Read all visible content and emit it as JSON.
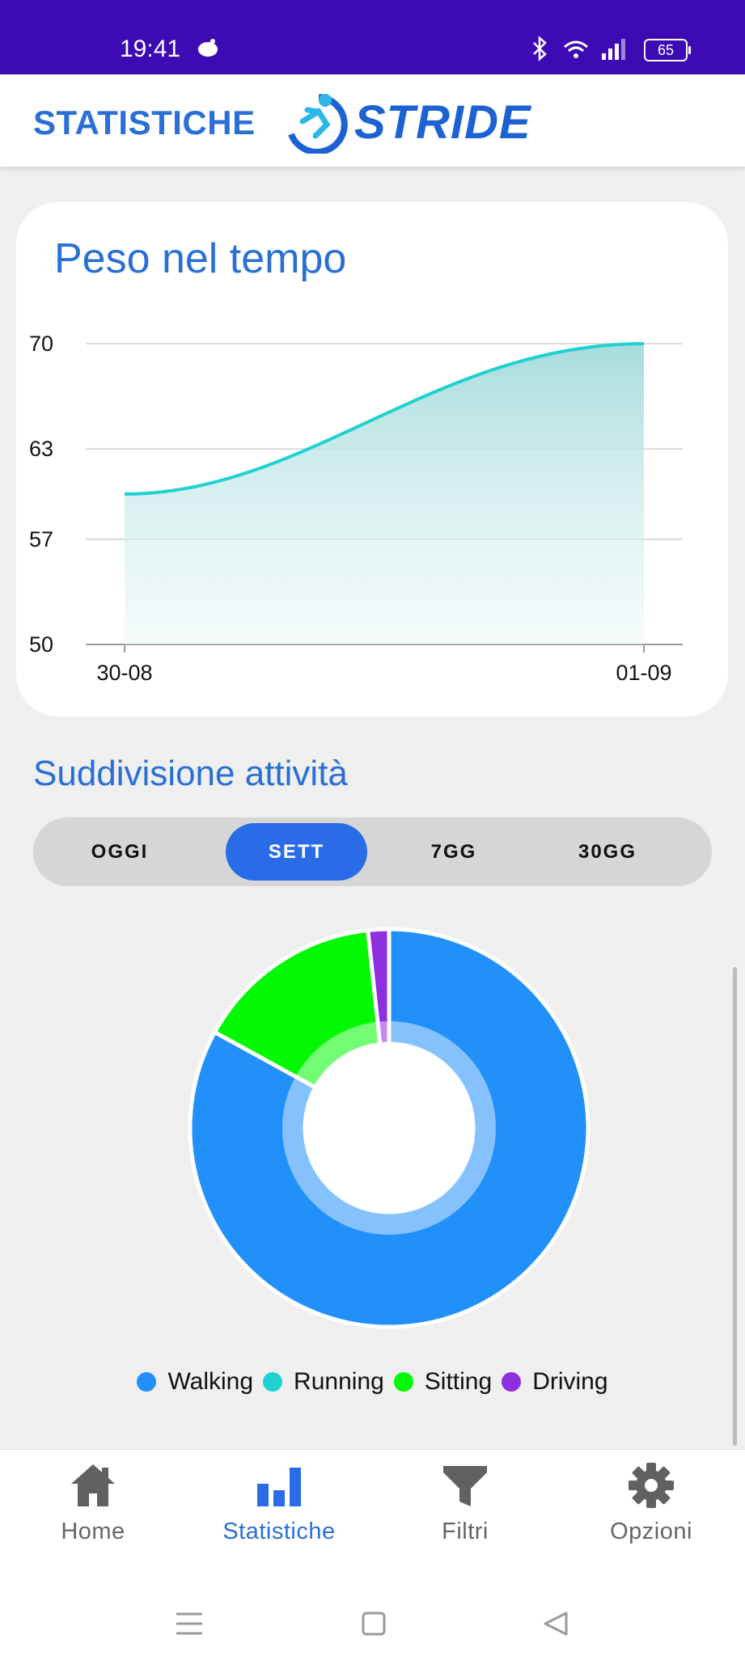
{
  "status_bar": {
    "time": "19:41",
    "battery": "65"
  },
  "header": {
    "title": "STATISTICHE",
    "logo_text": "STRIDE"
  },
  "weight_card": {
    "title": "Peso nel tempo"
  },
  "chart_data": {
    "type": "area",
    "x": [
      "30-08",
      "01-09"
    ],
    "y_ticks": [
      70,
      63,
      57,
      50
    ],
    "ylim": [
      50,
      70
    ],
    "series": [
      {
        "values": [
          60,
          70
        ]
      }
    ],
    "color": "#1fd1d1",
    "grid": true
  },
  "activity": {
    "title": "Suddivisione attività",
    "tabs": [
      "OGGI",
      "SETT",
      "7GG",
      "30GG"
    ],
    "selected_tab": "SETT",
    "donut": {
      "slices": [
        {
          "name": "Walking",
          "value": 83,
          "color": "#2290fb"
        },
        {
          "name": "Running",
          "value": 0,
          "color": "#1fd1d1"
        },
        {
          "name": "Sitting",
          "value": 15.3,
          "color": "#03f903"
        },
        {
          "name": "Driving",
          "value": 1.7,
          "color": "#8e2fe0"
        }
      ]
    },
    "legend": [
      {
        "label": "Walking",
        "color": "#2290fb"
      },
      {
        "label": "Running",
        "color": "#1fd1d1"
      },
      {
        "label": "Sitting",
        "color": "#03f903"
      },
      {
        "label": "Driving",
        "color": "#8e2fe0"
      }
    ]
  },
  "bottom_nav": {
    "items": [
      {
        "label": "Home",
        "icon": "home-icon"
      },
      {
        "label": "Statistiche",
        "icon": "bar-chart-icon"
      },
      {
        "label": "Filtri",
        "icon": "filter-icon"
      },
      {
        "label": "Opzioni",
        "icon": "gear-icon"
      }
    ],
    "active": "Statistiche"
  }
}
